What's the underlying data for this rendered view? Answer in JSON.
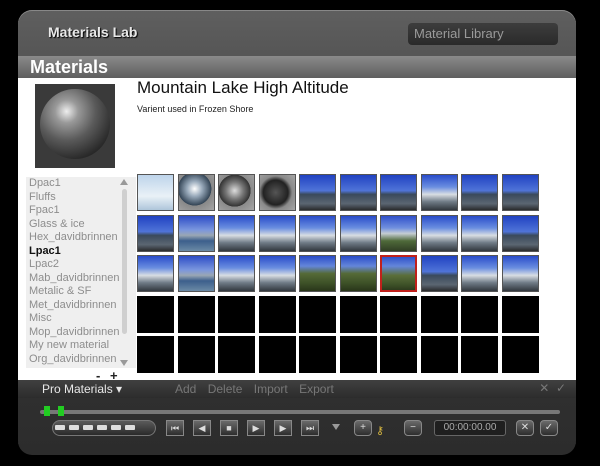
{
  "window": {
    "title": "Materials Lab",
    "library_tab": "Material Library"
  },
  "panel": {
    "title": "Materials"
  },
  "material": {
    "name": "Mountain Lake High Altitude",
    "description": "Varient used in Frozen Shore"
  },
  "list": {
    "items": [
      "Dpac1",
      "Fluffs",
      "Fpac1",
      "Glass & ice",
      "Hex_davidbrinnen",
      "Lpac1",
      "Lpac2",
      "Mab_davidbrinnen",
      "Metalic & SF",
      "Met_davidbrinnen",
      "Misc",
      "Mop_davidbrinnen",
      "My new material",
      "Org_davidbrinnen"
    ],
    "selected_index": 5,
    "minus": "-",
    "plus": "+"
  },
  "grid": {
    "columns": 10,
    "rows": 5,
    "selected_cell": 26,
    "cells": [
      "snow",
      "ice-sphere",
      "rock-sphere",
      "dark-rock",
      "mountain-sky",
      "mountain-sky",
      "mountain-sky",
      "snowy-peak",
      "mountain-sky",
      "mountain-sky",
      "mountain-sky",
      "lake",
      "snowy-peak",
      "snowy-peak",
      "snowy-peak",
      "snowy-peak",
      "green-peak",
      "snowy-peak",
      "snowy-peak",
      "mountain-sky",
      "snowy-peak",
      "lake",
      "snowy-peak",
      "snowy-peak",
      "green-hill",
      "green-hill",
      "green-field",
      "mountain-sky",
      "snowy-peak",
      "snowy-peak",
      "empty",
      "empty",
      "empty",
      "empty",
      "empty",
      "empty",
      "empty",
      "empty",
      "empty",
      "empty",
      "empty",
      "empty",
      "empty",
      "empty",
      "empty",
      "empty",
      "empty",
      "empty",
      "empty",
      "empty"
    ]
  },
  "bottom_bar": {
    "pro_materials": "Pro Materials ▾",
    "actions": [
      "Add",
      "Delete",
      "Import",
      "Export"
    ],
    "icons": [
      "close-icon",
      "check-icon"
    ]
  },
  "transport": {
    "time": "00:00:00.00",
    "buttons": [
      "skip-start",
      "step-back",
      "stop",
      "play",
      "step-forward",
      "skip-end"
    ]
  },
  "colors": {
    "accent_selected": "#c0201b",
    "sky": "#2a4fc8",
    "panel": "#ffffff"
  }
}
